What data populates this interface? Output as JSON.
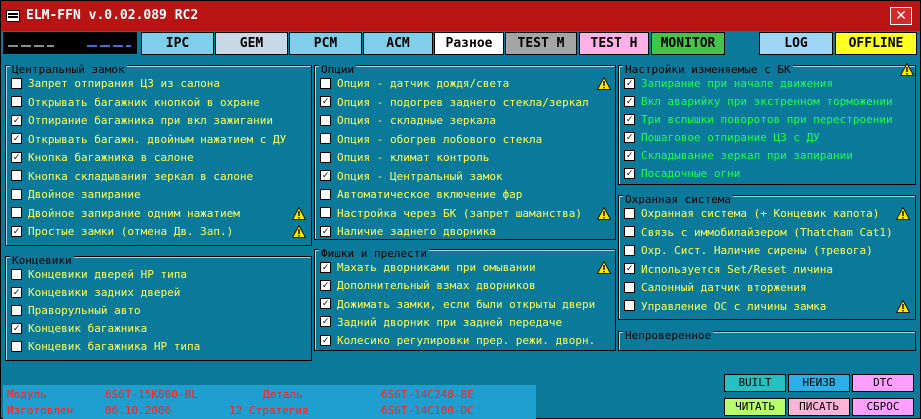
{
  "window": {
    "title": "ELM-FFN    v.0.02.089 RC2",
    "close_glyph": "✕"
  },
  "tabs": [
    {
      "label": "IPC",
      "bg": "#7fcfea"
    },
    {
      "label": "GEM",
      "bg": "#c9d8e6"
    },
    {
      "label": "PCM",
      "bg": "#7fcfea"
    },
    {
      "label": "ACM",
      "bg": "#7fcfea"
    },
    {
      "label": "Разное",
      "bg": "#ffffff"
    },
    {
      "label": "TEST M",
      "bg": "#a5a5a5"
    },
    {
      "label": "TEST H",
      "bg": "#ffb1e6"
    },
    {
      "label": "MONITOR",
      "bg": "#45c44a"
    },
    {
      "label": "LOG",
      "bg": "#9fd6f6"
    },
    {
      "label": "OFFLINE",
      "bg": "#ffff22"
    }
  ],
  "central_lock": {
    "title": "Центральный замок",
    "items": [
      {
        "label": "Запрет отпирания ЦЗ из салона",
        "checked": false,
        "warn": false
      },
      {
        "label": "Открывать багажник кнопкой в охране",
        "checked": false,
        "warn": false
      },
      {
        "label": "Отпирание багажника при вкл зажигании",
        "checked": true,
        "warn": false
      },
      {
        "label": "Открывать багажн. двойным нажатием с ДУ",
        "checked": true,
        "warn": false
      },
      {
        "label": "Кнопка багажника в салоне",
        "checked": true,
        "warn": false
      },
      {
        "label": "Кнопка складывания зеркал в салоне",
        "checked": false,
        "warn": false
      },
      {
        "label": "Двойное запирание",
        "checked": false,
        "warn": false
      },
      {
        "label": "Двойное запирание одним нажатием",
        "checked": false,
        "warn": true
      },
      {
        "label": "Простые замки (отмена Дв. Зап.)",
        "checked": true,
        "warn": true
      }
    ]
  },
  "limit_switches": {
    "title": "Концевики",
    "items": [
      {
        "label": "Концевики дверей НР типа",
        "checked": false
      },
      {
        "label": "Концевики задних дверей",
        "checked": true
      },
      {
        "label": "Праворульный авто",
        "checked": false
      },
      {
        "label": "Концевик багажника",
        "checked": true
      },
      {
        "label": "Концевик багажника НР типа",
        "checked": false
      }
    ]
  },
  "options": {
    "title": "Опции",
    "items": [
      {
        "label": "Опция - датчик дождя/света",
        "checked": false,
        "warn": true
      },
      {
        "label": "Опция - подогрев заднего стекла/зеркал",
        "checked": true,
        "warn": false
      },
      {
        "label": "Опция - складные зеркала",
        "checked": false,
        "warn": false
      },
      {
        "label": "Опция - обогрев лобового стекла",
        "checked": false,
        "warn": false
      },
      {
        "label": "Опция - климат контроль",
        "checked": false,
        "warn": false
      },
      {
        "label": "Опция - Центральный замок",
        "checked": true,
        "warn": false
      },
      {
        "label": "Автоматическое включение фар",
        "checked": false,
        "warn": false
      },
      {
        "label": "Настройка через БК (запрет шаманства)",
        "checked": false,
        "warn": true
      },
      {
        "label": "Наличие заднего дворника",
        "checked": true,
        "warn": false
      }
    ]
  },
  "features": {
    "title": "Фишки и прелести",
    "items": [
      {
        "label": "Махать дворниками при омывании",
        "checked": true,
        "warn": true
      },
      {
        "label": "Дополнительный взмах дворников",
        "checked": true,
        "warn": false
      },
      {
        "label": "Дожимать замки, если были открыты двери",
        "checked": true,
        "warn": false
      },
      {
        "label": "Задний дворник при задней передаче",
        "checked": true,
        "warn": false
      },
      {
        "label": "Колесико регулировки прер. режи. дворн.",
        "checked": true,
        "warn": false
      }
    ]
  },
  "bk_settings": {
    "title": "Настройки изменяемые с БК",
    "items": [
      {
        "label": "Запирание при начале движения",
        "checked": true
      },
      {
        "label": "Вкл аварийку при экстренном торможении",
        "checked": true
      },
      {
        "label": "Три вспышки поворотов при перестроении",
        "checked": true
      },
      {
        "label": "Пошаговое отпирание ЦЗ с ДУ",
        "checked": true
      },
      {
        "label": "Складывание зеркал при запирании",
        "checked": true
      },
      {
        "label": "Посадочные огни",
        "checked": true
      }
    ]
  },
  "alarm": {
    "title": "Охранная система",
    "items": [
      {
        "label": "Охранная система (+ Концевик капота)",
        "checked": false,
        "warn": true
      },
      {
        "label": "Связь с иммобилайзером (Thatcham Cat1)",
        "checked": false,
        "warn": false
      },
      {
        "label": "Охр. Сист. Наличие сирены (тревога)",
        "checked": false,
        "warn": false
      },
      {
        "label": "Используется Set/Reset личина",
        "checked": true,
        "warn": false
      },
      {
        "label": "Салонный датчик вторжения",
        "checked": false,
        "warn": false
      },
      {
        "label": "Управление ОС с личины замка",
        "checked": false,
        "warn": true
      }
    ]
  },
  "unverified": {
    "title": "Непроверенное"
  },
  "info": {
    "module_label": "Модуль",
    "module_value": "6S6T-15K600-BL",
    "detail_label": "Деталь",
    "detail_value": "6S6T-14C248-BE",
    "made_label": "Изготовлен",
    "made_value": "06.10.2006",
    "extra": "12",
    "strategy_label": "Стратегия",
    "strategy_value": "6S6T-14C100-DC"
  },
  "bottom_buttons": [
    {
      "label": "BUILT",
      "bg": "#25c1c1",
      "color": "#000"
    },
    {
      "label": "НЕИЗВ",
      "bg": "#2ab0e6",
      "color": "#000"
    },
    {
      "label": "DTC",
      "bg": "#ff9fff",
      "color": "#000"
    },
    {
      "label": "ЧИТАТЬ",
      "bg": "#b7ff6a",
      "color": "#000"
    },
    {
      "label": "ПИСАТЬ",
      "bg": "#ffb3d9",
      "color": "#000"
    },
    {
      "label": "СБРОС",
      "bg": "#ff9fff",
      "color": "#000"
    }
  ],
  "colors": {
    "panel_bg": "#0b7a9a",
    "title_bar": "#b81414",
    "text_yellow": "#ffff55",
    "text_green": "#1cff4e",
    "warn": "#ffe600"
  }
}
